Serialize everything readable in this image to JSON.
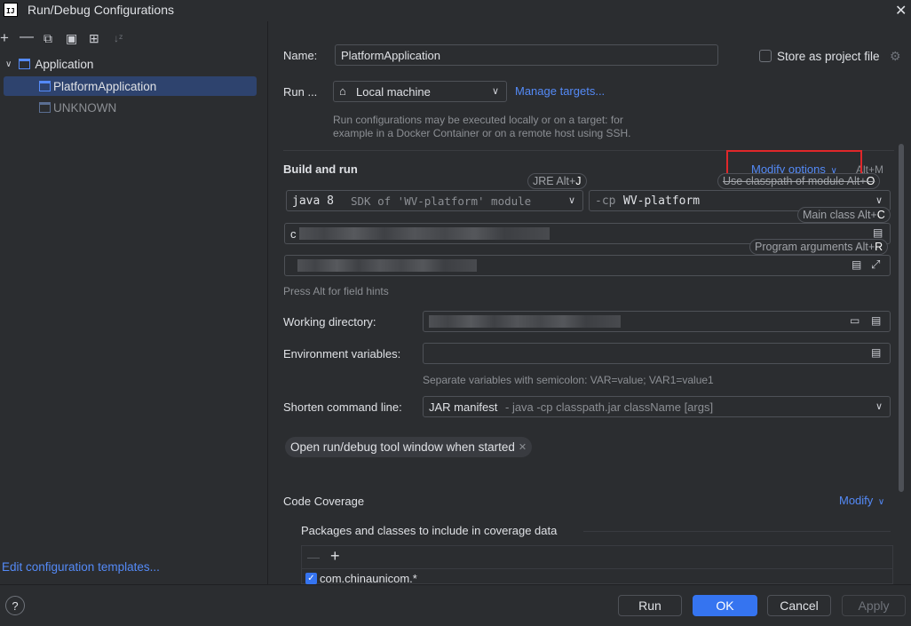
{
  "window": {
    "title": "Run/Debug Configurations",
    "logo_text": "IJ"
  },
  "toolbar": {
    "icons": [
      "add-icon",
      "remove-icon",
      "copy-icon",
      "save-icon",
      "new-folder-icon",
      "sort-icon"
    ]
  },
  "tree": {
    "group_label": "Application",
    "items": [
      {
        "label": "PlatformApplication",
        "selected": true
      },
      {
        "label": "UNKNOWN",
        "selected": false
      }
    ]
  },
  "left_footer": {
    "edit_templates": "Edit configuration templates..."
  },
  "form": {
    "name_label": "Name:",
    "name_value": "PlatformApplication",
    "store_label": "Store as project file",
    "run_on_label": "Run ...",
    "run_on_value": "Local machine",
    "manage_targets": "Manage targets...",
    "run_on_hint_line1": "Run configurations may be executed locally or on a target: for",
    "run_on_hint_line2": "example in a Docker Container or on a remote host using SSH.",
    "build_run_title": "Build and run",
    "modify_options": "Modify options",
    "modify_options_shortcut": "Alt+M",
    "jre_value_a": "java 8",
    "jre_value_b": "SDK of 'WV-platform' module",
    "cp_prefix": "-cp",
    "cp_value": "WV-platform",
    "main_class_prefix": "c",
    "field_hint": "Press Alt for field hints",
    "working_dir_label": "Working directory:",
    "env_label": "Environment variables:",
    "env_hint": "Separate variables with semicolon: VAR=value; VAR1=value1",
    "shorten_label": "Shorten command line:",
    "shorten_value": "JAR manifest",
    "shorten_detail": "- java -cp classpath.jar className [args]",
    "tag_chip": "Open run/debug tool window when started",
    "coverage_title": "Code Coverage",
    "coverage_modify": "Modify",
    "packages_title": "Packages and classes to include in coverage data",
    "package_item": "com.chinaunicom.*"
  },
  "hints": {
    "jre": {
      "text": "JRE Alt+",
      "key": "J"
    },
    "classpath": {
      "text": "Use classpath of module Alt+",
      "key": "O"
    },
    "main_class": {
      "text": "Main class Alt+",
      "key": "C"
    },
    "program_args": {
      "text": "Program arguments Alt+",
      "key": "R"
    }
  },
  "buttons": {
    "run": "Run",
    "ok": "OK",
    "cancel": "Cancel",
    "apply": "Apply",
    "help": "?"
  },
  "colors": {
    "accent": "#3574f0",
    "link": "#548af7",
    "highlight_box": "#e0272a",
    "selection": "#2e436e"
  }
}
